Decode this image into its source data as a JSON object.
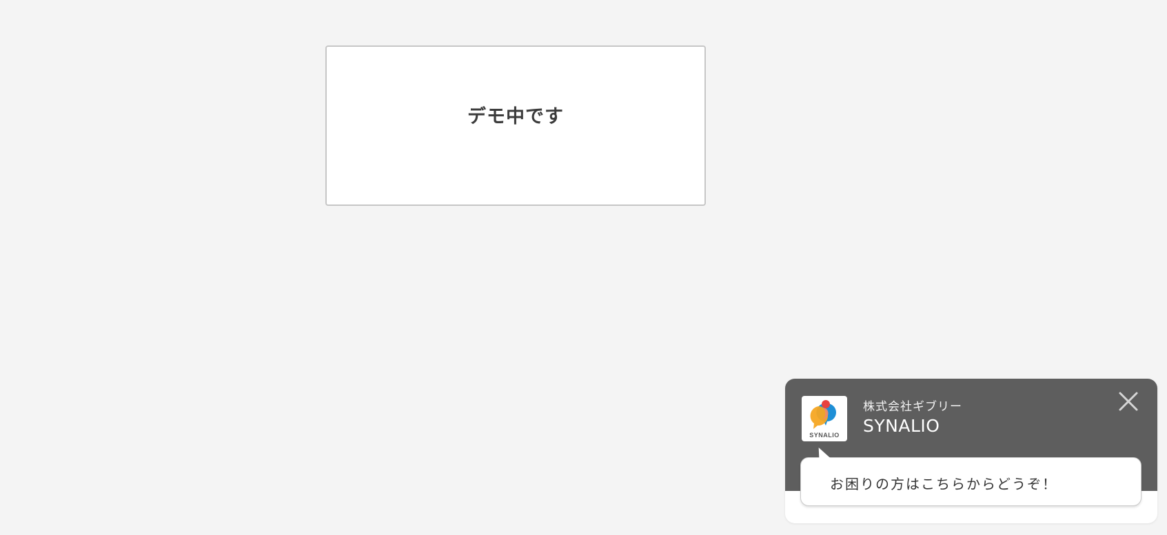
{
  "demo": {
    "message": "デモ中です"
  },
  "widget": {
    "logo_text": "SYNALIO",
    "company_name": "株式会社ギブリー",
    "service_name": "SYNALIO",
    "bubble_message": "お困りの方はこちらからどうぞ！",
    "colors": {
      "header_bg": "#5e5e5e",
      "logo_orange": "#f5a623",
      "logo_blue": "#1e8fd6",
      "logo_red": "#e8423f"
    }
  }
}
